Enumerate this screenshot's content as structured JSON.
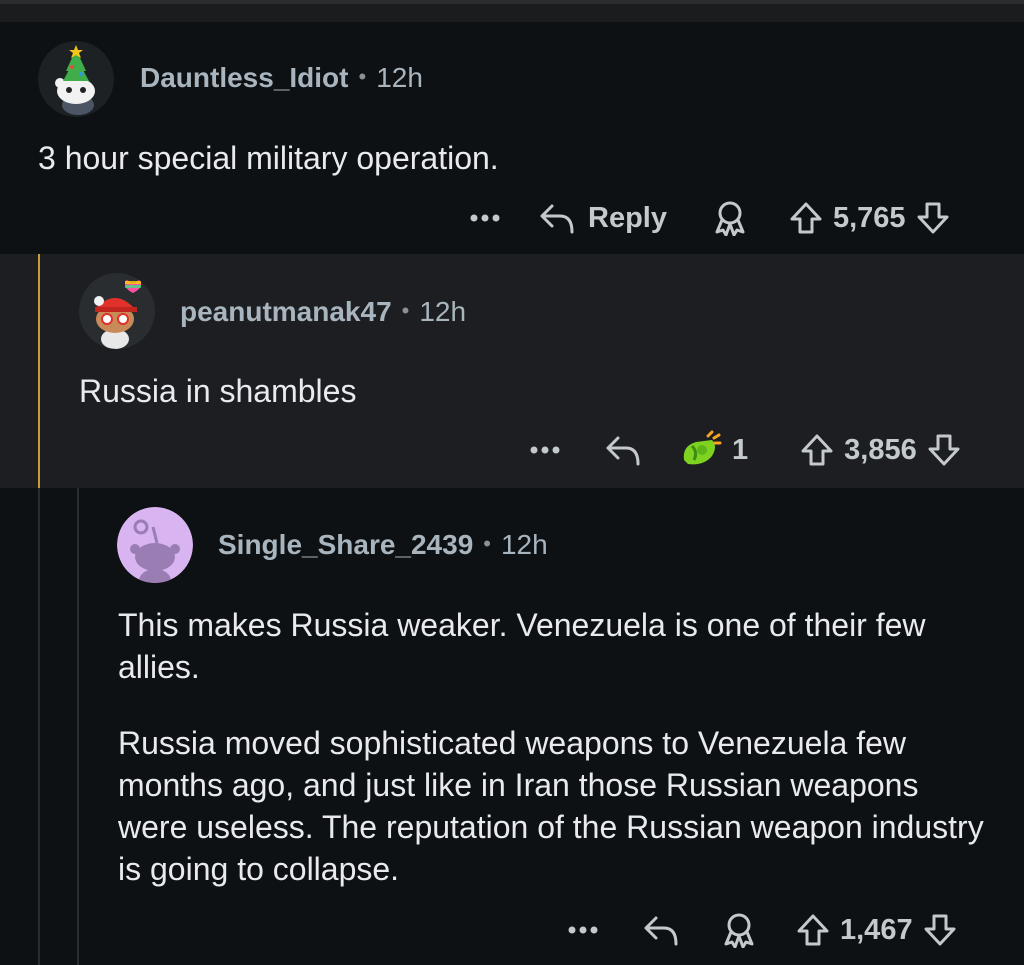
{
  "comments": [
    {
      "username": "Dauntless_Idiot",
      "time": "12h",
      "paragraphs": [
        "3 hour special military operation."
      ],
      "reply_label": "Reply",
      "score": "5,765"
    },
    {
      "username": "peanutmanak47",
      "time": "12h",
      "paragraphs": [
        "Russia in shambles"
      ],
      "award_count": "1",
      "score": "3,856"
    },
    {
      "username": "Single_Share_2439",
      "time": "12h",
      "paragraphs": [
        "This makes Russia weaker. Venezuela is one of their few allies.",
        "Russia moved sophisticated weapons to Venezuela few months ago, and just like in Iran those Russian weapons were useless. The reputation of the Russian weapon industry is going to collapse."
      ],
      "score": "1,467"
    }
  ],
  "separator": "•",
  "more_label": "•••",
  "colors": {
    "background": "#0e1113",
    "highlight_background": "#1c1e21",
    "thread_highlight": "#c79b3a",
    "thread_line": "#2a2d30",
    "username": "#a9b5be",
    "body_text": "#e8eaed"
  },
  "icons": {
    "more": "more-icon",
    "reply": "reply-arrow-icon",
    "award": "award-ribbon-icon",
    "gift_award": "gift-award-icon",
    "upvote": "upvote-arrow-icon",
    "downvote": "downvote-arrow-icon"
  }
}
